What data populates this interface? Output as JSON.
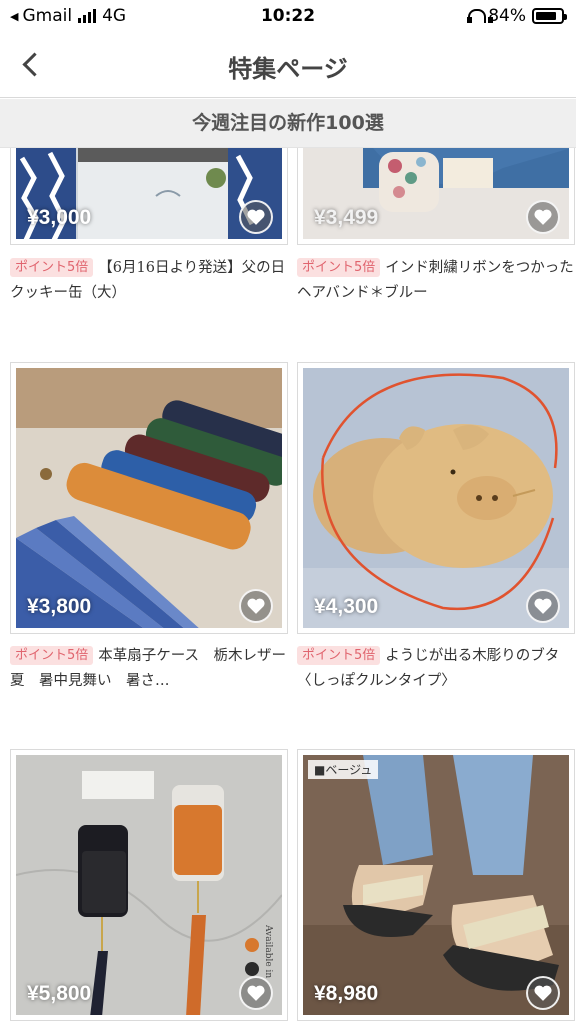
{
  "status_bar": {
    "carrier": "Gmail",
    "network": "4G",
    "time": "10:22",
    "battery": "84%",
    "battery_level": 0.84
  },
  "nav": {
    "title": "特集ページ"
  },
  "section": {
    "title": "今週注目の新作100選"
  },
  "products": [
    {
      "price": "¥3,000",
      "badge": "ポイント5倍",
      "title": "【6月16日より発送】父の日クッキー缶（大）"
    },
    {
      "price": "¥3,499",
      "badge": "ポイント5倍",
      "title": "インド刺繍リボンをつかったヘアバンド＊ブルー"
    },
    {
      "price": "¥3,800",
      "badge": "ポイント5倍",
      "title": "本革扇子ケース　栃木レザー　夏　暑中見舞い　暑さ…"
    },
    {
      "price": "¥4,300",
      "badge": "ポイント5倍",
      "title": "ようじが出る木彫りのブタ〈しっぽクルンタイプ〉"
    },
    {
      "price": "¥5,800",
      "badge": "",
      "title": ""
    },
    {
      "price": "¥8,980",
      "badge": "",
      "title": "",
      "photo_tag": "■ベージュ"
    }
  ]
}
